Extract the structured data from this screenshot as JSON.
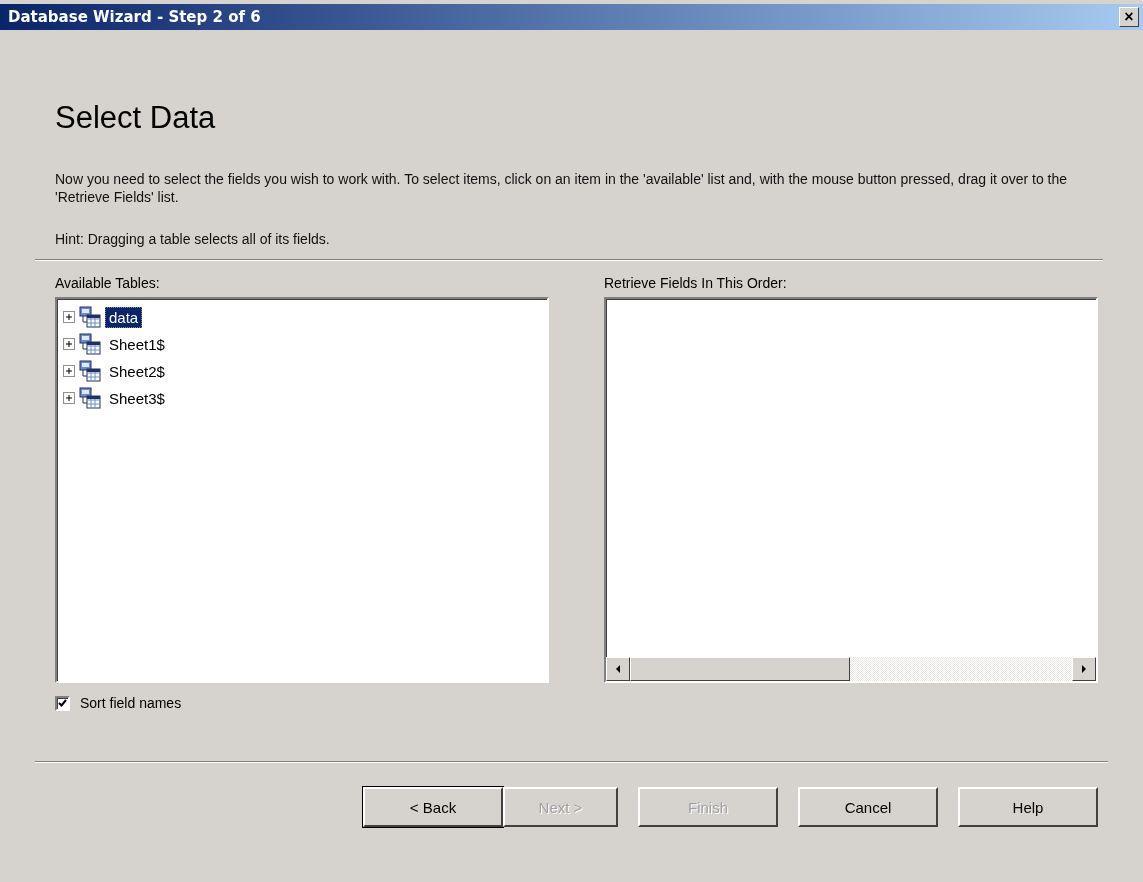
{
  "window": {
    "title": "Database Wizard - Step 2 of 6",
    "close": "×"
  },
  "heading": "Select Data",
  "instructions": "Now you need to select the fields you wish to work with. To select items, click on an item in the 'available' list and, with the mouse button pressed, drag it over to the 'Retrieve Fields' list.",
  "hint": "Hint: Dragging a table selects all of its fields.",
  "available_tables": {
    "label": "Available Tables:",
    "items": [
      {
        "label": "data",
        "expanded": false,
        "selected": true
      },
      {
        "label": "Sheet1$",
        "expanded": false,
        "selected": false
      },
      {
        "label": "Sheet2$",
        "expanded": false,
        "selected": false
      },
      {
        "label": "Sheet3$",
        "expanded": false,
        "selected": false
      }
    ]
  },
  "retrieve_fields": {
    "label": "Retrieve Fields In This Order:"
  },
  "sort_field_names": {
    "label": "Sort field names",
    "checked": true
  },
  "buttons": [
    {
      "label": "< Back",
      "disabled": false,
      "default": true
    },
    {
      "label": "Next >",
      "disabled": true,
      "default": false
    },
    {
      "label": "Finish",
      "disabled": true,
      "default": false
    },
    {
      "label": "Cancel",
      "disabled": false,
      "default": false
    },
    {
      "label": "Help",
      "disabled": false,
      "default": false
    }
  ]
}
